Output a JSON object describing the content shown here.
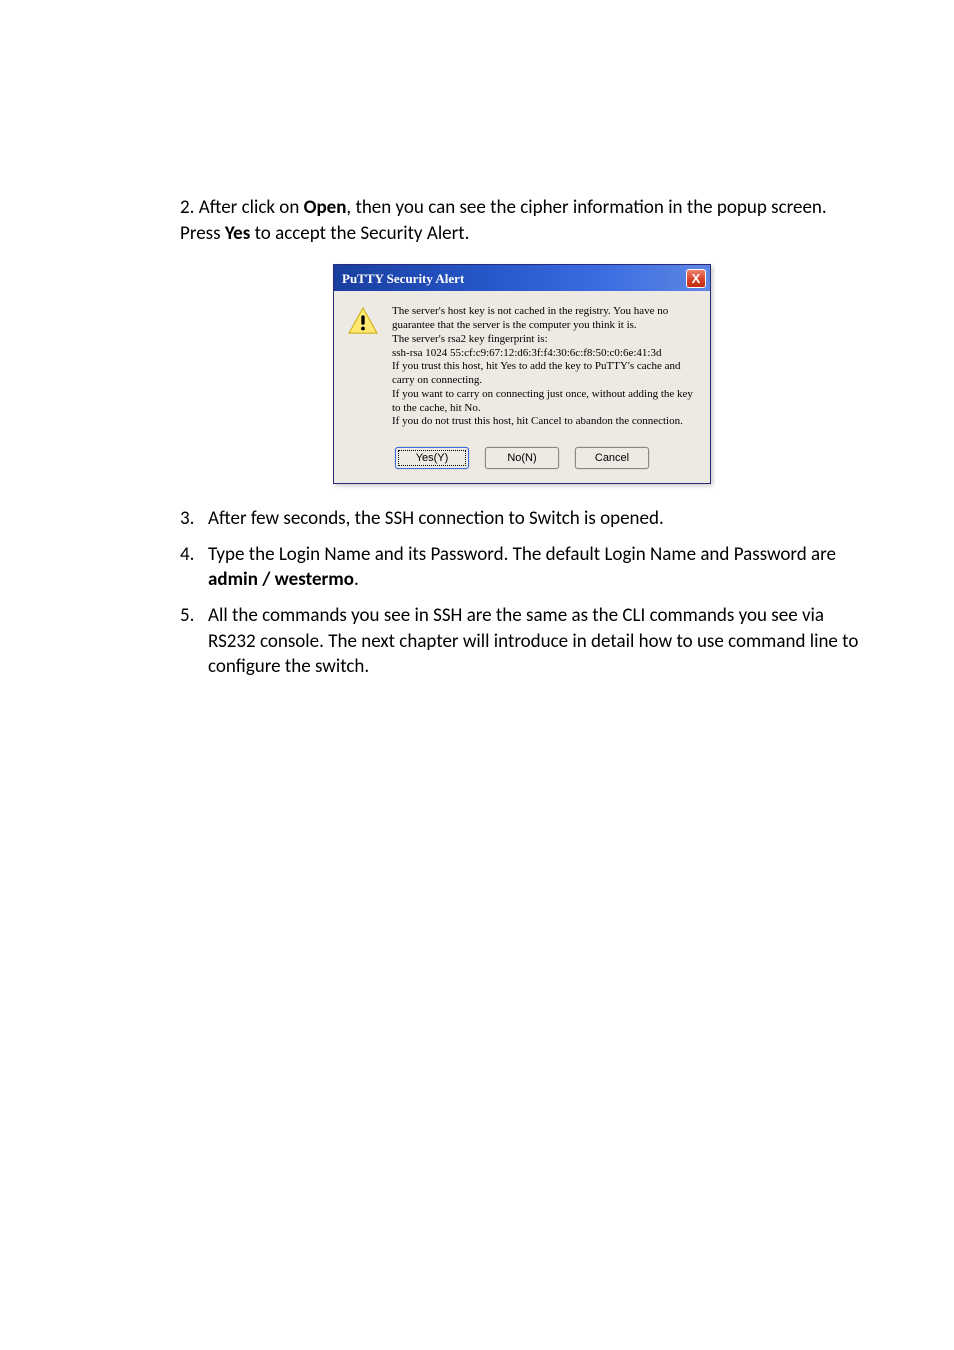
{
  "intro": {
    "prefix": "2. After click on ",
    "open_word": "Open",
    "mid": ", then you can see the cipher information in the popup screen. Press ",
    "yes_word": "Yes",
    "suffix": " to accept the Security Alert."
  },
  "dialog": {
    "title": "PuTTY Security Alert",
    "close_label": "X",
    "body_text": "The server's host key is not cached in the registry. You have no guarantee that the server is the computer you think it is.\nThe server's rsa2 key fingerprint is:\nssh-rsa 1024 55:cf:c9:67:12:d6:3f:f4:30:6c:f8:50:c0:6e:41:3d\nIf you trust this host, hit Yes to add the key to PuTTY's cache and carry on connecting.\nIf you want to carry on connecting just once, without adding the key to the cache, hit No.\nIf you do not trust this host, hit Cancel to abandon the connection.",
    "buttons": {
      "yes": "Yes(Y)",
      "no": "No(N)",
      "cancel": "Cancel"
    }
  },
  "steps": {
    "item3": {
      "num": "3.",
      "text": "After few seconds, the SSH connection to Switch is opened."
    },
    "item4": {
      "num": "4.",
      "prefix": "Type the Login Name and its Password. The default Login Name and Password are ",
      "bold": "admin / westermo",
      "suffix": "."
    },
    "item5": {
      "num": "5.",
      "text": "All the commands you see in SSH are the same as the CLI commands you see via RS232 console. The next chapter will introduce in detail how to use command line to configure the switch."
    }
  }
}
